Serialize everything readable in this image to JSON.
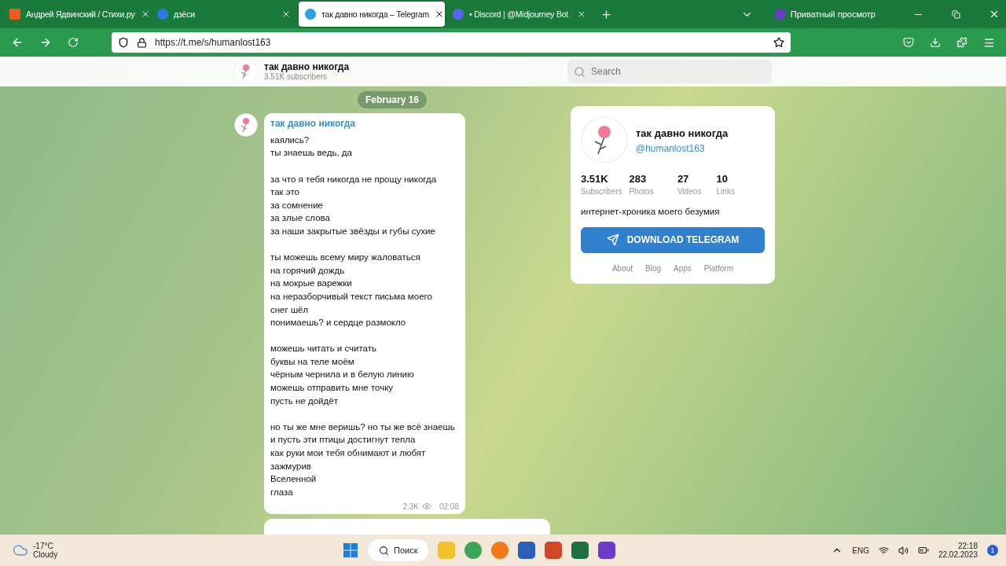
{
  "browser": {
    "tabs": [
      {
        "title": "Андрей Ядвинский / Стихи.ру",
        "kind": "square",
        "selected": false
      },
      {
        "title": "дзёси",
        "kind": "vk",
        "selected": false
      },
      {
        "title": "так давно никогда – Telegram",
        "kind": "telegram",
        "selected": true
      },
      {
        "title": "• Discord | @Midjourney Bot",
        "kind": "discord",
        "selected": false
      }
    ],
    "private_label": "Приватный просмотр",
    "url": "https://t.me/s/humanlost163"
  },
  "header": {
    "channel": "так давно никогда",
    "subscribers": "3.51K subscribers",
    "search_placeholder": "Search"
  },
  "date_badge": "February 16",
  "message": {
    "author": "так давно никогда",
    "stanzas": [
      [
        "каялись?",
        "ты знаешь ведь, да"
      ],
      [
        "за что я тебя никогда не прощу никогда",
        "так это",
        "за сомнение",
        "за злые слова",
        "за наши закрытые звёзды и губы сухие"
      ],
      [
        "ты можешь всему миру жаловаться",
        "на горячий дождь",
        "на мокрые варежки",
        "на неразборчивый текст письма моего",
        "снег шёл",
        "понимаешь? и сердце размокло"
      ],
      [
        "можешь читать и считать",
        "буквы на теле моём",
        "чёрным чернила и в белую линию",
        "можешь отправить мне точку",
        "пусть не дойдёт"
      ],
      [
        "но ты же мне веришь? но ты же всё знаешь",
        "и пусть эти птицы достигнут тепла",
        "как руки мои тебя обнимают и любят",
        "зажмурив",
        "Вселенной",
        "глаза"
      ]
    ],
    "views": "2.3K",
    "time": "02:08"
  },
  "card": {
    "name": "так давно никогда",
    "handle": "@humanlost163",
    "stats": [
      {
        "value": "3.51K",
        "label": "Subscribers"
      },
      {
        "value": "283",
        "label": "Photos"
      },
      {
        "value": "27",
        "label": "Videos"
      },
      {
        "value": "10",
        "label": "Links"
      }
    ],
    "description": "интернет-хроника моего безумия",
    "button": "DOWNLOAD TELEGRAM",
    "links": [
      "About",
      "Blog",
      "Apps",
      "Platform"
    ]
  },
  "taskbar": {
    "temperature": "-17°C",
    "weather": "Cloudy",
    "search": "Поиск",
    "language": "ENG",
    "clock": "22:18",
    "date": "22.02.2023",
    "notifications": "1"
  }
}
